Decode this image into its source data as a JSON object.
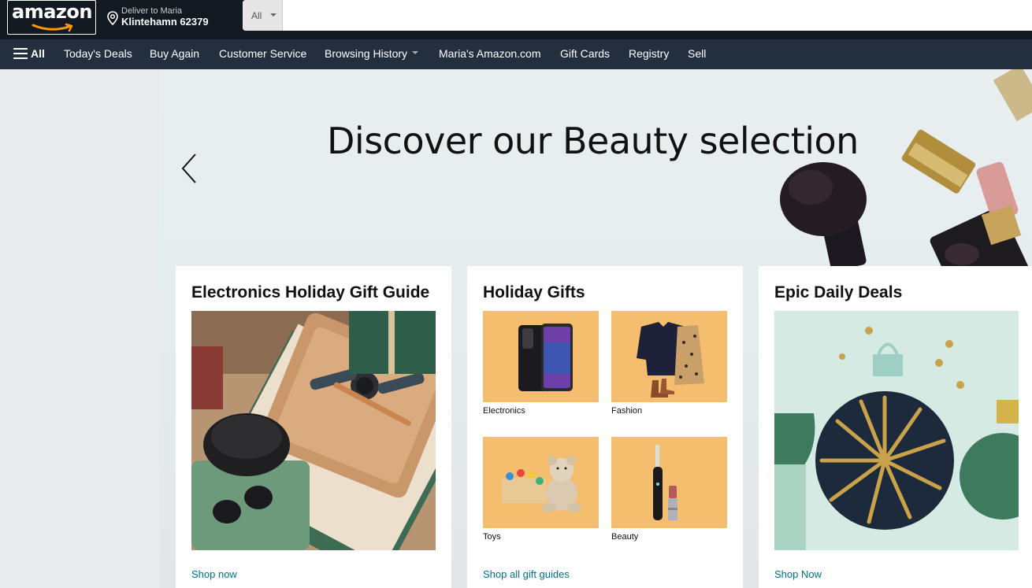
{
  "header": {
    "logo_text": "amazon",
    "deliver_line1": "Deliver to Maria",
    "deliver_line2": "Klintehamn 62379",
    "search": {
      "category": "All",
      "placeholder": ""
    }
  },
  "nav": {
    "all_label": "All",
    "items": [
      {
        "label": "Today's Deals"
      },
      {
        "label": "Buy Again"
      },
      {
        "label": "Customer Service"
      },
      {
        "label": "Browsing History"
      },
      {
        "label": "Maria's Amazon.com"
      },
      {
        "label": "Gift Cards"
      },
      {
        "label": "Registry"
      },
      {
        "label": "Sell"
      }
    ]
  },
  "hero": {
    "title": "Discover our Beauty selection"
  },
  "cards": [
    {
      "title": "Electronics Holiday Gift Guide",
      "link": "Shop now"
    },
    {
      "title": "Holiday Gifts",
      "link": "Shop all gift guides",
      "tiles": [
        {
          "label": "Electronics"
        },
        {
          "label": "Fashion"
        },
        {
          "label": "Toys"
        },
        {
          "label": "Beauty"
        }
      ]
    },
    {
      "title": "Epic Daily Deals",
      "link": "Shop Now"
    }
  ],
  "colors": {
    "header_bg": "#131921",
    "nav_bg": "#232f3e",
    "link": "#007185",
    "tile_bg": "#f4be6e",
    "accent": "#ff9900"
  }
}
